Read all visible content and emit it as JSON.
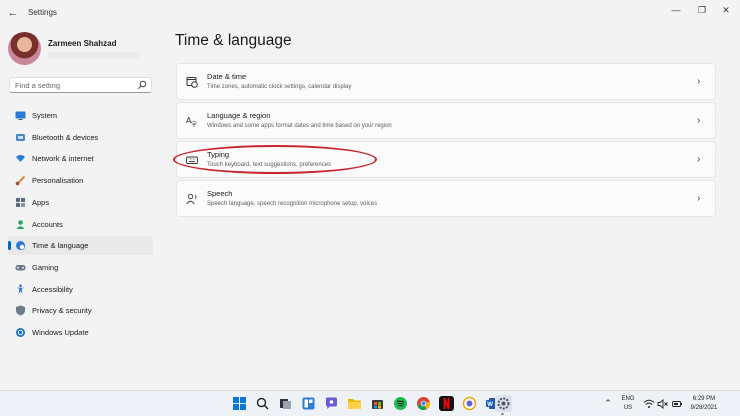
{
  "window": {
    "title": "Settings"
  },
  "profile": {
    "name": "Zarmeen Shahzad"
  },
  "search": {
    "placeholder": "Find a setting"
  },
  "sidebar": {
    "items": [
      {
        "label": "System",
        "icon": "monitor-icon",
        "active": false
      },
      {
        "label": "Bluetooth & devices",
        "icon": "bluetooth-icon",
        "active": false
      },
      {
        "label": "Network & internet",
        "icon": "wifi-icon",
        "active": false
      },
      {
        "label": "Personalisation",
        "icon": "brush-icon",
        "active": false
      },
      {
        "label": "Apps",
        "icon": "apps-grid-icon",
        "active": false
      },
      {
        "label": "Accounts",
        "icon": "person-icon",
        "active": false
      },
      {
        "label": "Time & language",
        "icon": "globe-clock-icon",
        "active": true
      },
      {
        "label": "Gaming",
        "icon": "gamepad-icon",
        "active": false
      },
      {
        "label": "Accessibility",
        "icon": "accessibility-icon",
        "active": false
      },
      {
        "label": "Privacy & security",
        "icon": "shield-icon",
        "active": false
      },
      {
        "label": "Windows Update",
        "icon": "update-icon",
        "active": false
      }
    ]
  },
  "main": {
    "title": "Time & language",
    "cards": [
      {
        "title": "Date & time",
        "subtitle": "Time zones, automatic clock settings, calendar display",
        "icon": "calendar-clock-icon"
      },
      {
        "title": "Language & region",
        "subtitle": "Windows and some apps format dates and time based on your region",
        "icon": "language-icon"
      },
      {
        "title": "Typing",
        "subtitle": "Touch keyboard, text suggestions, preferences",
        "icon": "keyboard-icon"
      },
      {
        "title": "Speech",
        "subtitle": "Speech language, speech recognition microphone setup, voices",
        "icon": "speech-icon"
      }
    ]
  },
  "taskbar": {
    "apps": [
      "start-icon",
      "search-icon",
      "task-view-icon",
      "widgets-icon",
      "chat-icon",
      "file-explorer-icon",
      "store-icon",
      "spotify-icon",
      "chrome-icon",
      "netflix-icon",
      "photos-icon",
      "word-icon",
      "settings-icon"
    ],
    "lang_top": "ENG",
    "lang_bottom": "US",
    "time": "6:29 PM",
    "date": "9/28/2021"
  },
  "colors": {
    "accent": "#0067c0",
    "highlight": "#c8262f"
  }
}
